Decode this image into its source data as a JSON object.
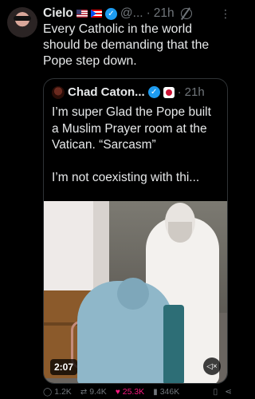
{
  "post": {
    "author_name": "Cielo",
    "handle": "@...",
    "separator": "·",
    "time": "21h",
    "text": "Every Catholic in the world should be demanding that the Pope step down."
  },
  "quoted": {
    "author_name": "Chad Caton...",
    "separator": "·",
    "time": "21h",
    "text_lines": [
      "I’m super Glad the Pope built a Muslim Prayer room at the Vatican. “Sarcasm”",
      "I’m not coexisting with thi..."
    ],
    "video_duration": "2:07"
  },
  "actions": {
    "replies": "1.2K",
    "reposts": "9.4K",
    "likes": "25.3K",
    "views": "346K"
  },
  "icons": {
    "verified": "verified-badge-icon",
    "more": "more-icon",
    "reply": "reply-icon",
    "repost": "repost-icon",
    "like": "heart-icon",
    "views": "views-icon",
    "bookmark": "bookmark-icon",
    "share": "share-icon",
    "sound": "mute-icon"
  },
  "colors": {
    "background": "#000000",
    "accent": "#1d9bf0",
    "like": "#f91880",
    "muted": "#71767b"
  }
}
